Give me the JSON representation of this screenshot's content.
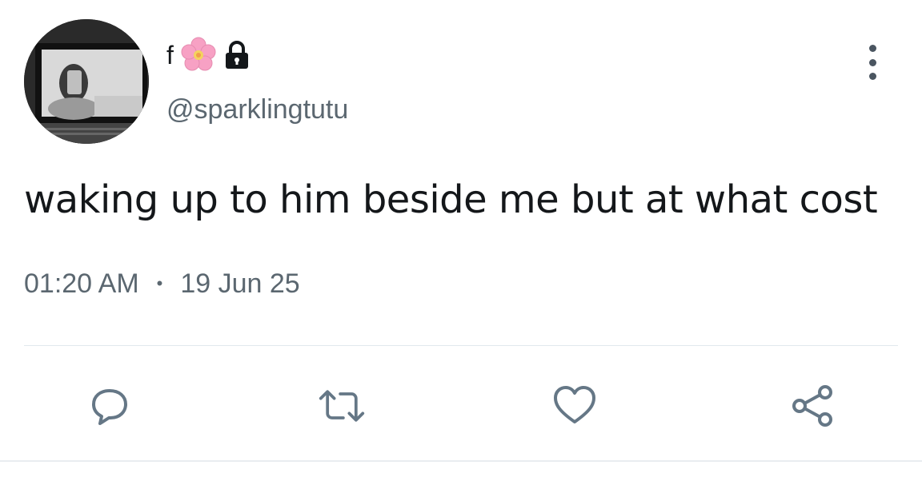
{
  "tweet": {
    "display_name": "f",
    "name_emoji_icons": [
      "flower-icon",
      "lock-icon"
    ],
    "handle": "@sparklingtutu",
    "text": "waking up to him beside me but at what cost",
    "time": "01:20 AM",
    "separator": "•",
    "date": "19 Jun 25"
  },
  "actions": [
    "reply-icon",
    "retweet-icon",
    "like-icon",
    "share-icon"
  ],
  "colors": {
    "text_primary": "#14171a",
    "text_secondary": "#5b6770",
    "icon": "#657786",
    "divider": "#e1e8ed",
    "flower_pink": "#f7a1c4"
  }
}
